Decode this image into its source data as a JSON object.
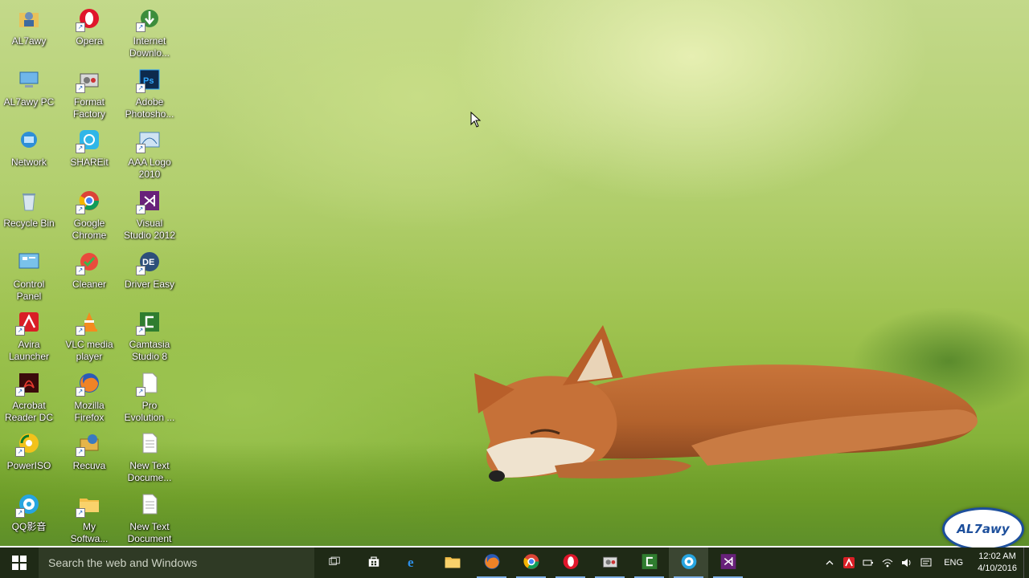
{
  "desktop_icons": [
    {
      "label": "AL7awy",
      "icon": "user-folder-icon"
    },
    {
      "label": "Opera",
      "icon": "opera-icon"
    },
    {
      "label": "Internet\nDownlo...",
      "icon": "idm-icon"
    },
    {
      "label": "AL7awy PC",
      "icon": "computer-icon"
    },
    {
      "label": "Format\nFactory",
      "icon": "format-factory-icon"
    },
    {
      "label": "Adobe\nPhotosho...",
      "icon": "photoshop-icon"
    },
    {
      "label": "Network",
      "icon": "network-icon"
    },
    {
      "label": "SHAREit",
      "icon": "shareit-icon"
    },
    {
      "label": "AAA Logo\n2010",
      "icon": "aaa-logo-icon"
    },
    {
      "label": "Recycle Bin",
      "icon": "recycle-bin-icon"
    },
    {
      "label": "Google\nChrome",
      "icon": "chrome-icon"
    },
    {
      "label": "Visual\nStudio 2012",
      "icon": "visual-studio-icon"
    },
    {
      "label": "Control\nPanel",
      "icon": "control-panel-icon"
    },
    {
      "label": "Cleaner",
      "icon": "cleaner-icon"
    },
    {
      "label": "Driver Easy",
      "icon": "driver-easy-icon"
    },
    {
      "label": "Avira\nLauncher",
      "icon": "avira-icon"
    },
    {
      "label": "VLC media\nplayer",
      "icon": "vlc-icon"
    },
    {
      "label": "Camtasia\nStudio 8",
      "icon": "camtasia-icon"
    },
    {
      "label": "Acrobat\nReader DC",
      "icon": "acrobat-icon"
    },
    {
      "label": "Mozilla\nFirefox",
      "icon": "firefox-icon"
    },
    {
      "label": "Pro\nEvolution ...",
      "icon": "document-icon"
    },
    {
      "label": "PowerISO",
      "icon": "poweriso-icon"
    },
    {
      "label": "Recuva",
      "icon": "recuva-icon"
    },
    {
      "label": "New Text\nDocume...",
      "icon": "text-document-icon"
    },
    {
      "label": "QQ影音",
      "icon": "qq-player-icon"
    },
    {
      "label": "My\nSoftwa...",
      "icon": "folder-icon"
    },
    {
      "label": "New Text\nDocument",
      "icon": "text-document-icon"
    }
  ],
  "taskbar": {
    "search_placeholder": "Search the web and Windows",
    "pinned": [
      {
        "name": "task-view",
        "icon": "task-view-icon"
      },
      {
        "name": "store",
        "icon": "store-icon"
      },
      {
        "name": "edge",
        "icon": "edge-icon"
      },
      {
        "name": "file-explorer",
        "icon": "folder-icon"
      },
      {
        "name": "firefox",
        "icon": "firefox-icon"
      },
      {
        "name": "chrome",
        "icon": "chrome-icon"
      },
      {
        "name": "opera",
        "icon": "opera-icon"
      },
      {
        "name": "format-factory",
        "icon": "format-factory-icon"
      },
      {
        "name": "camtasia",
        "icon": "camtasia-icon"
      },
      {
        "name": "qq-player",
        "icon": "qq-player-icon"
      },
      {
        "name": "visual-studio",
        "icon": "visual-studio-icon"
      }
    ],
    "language": "ENG",
    "time": "12:02 AM",
    "date": "4/10/2016"
  },
  "watermark_text": "AL7awy",
  "colors": {
    "taskbar_bg": "#1f2a16",
    "search_bg": "#2f3a25",
    "label_text": "#ffffff"
  }
}
